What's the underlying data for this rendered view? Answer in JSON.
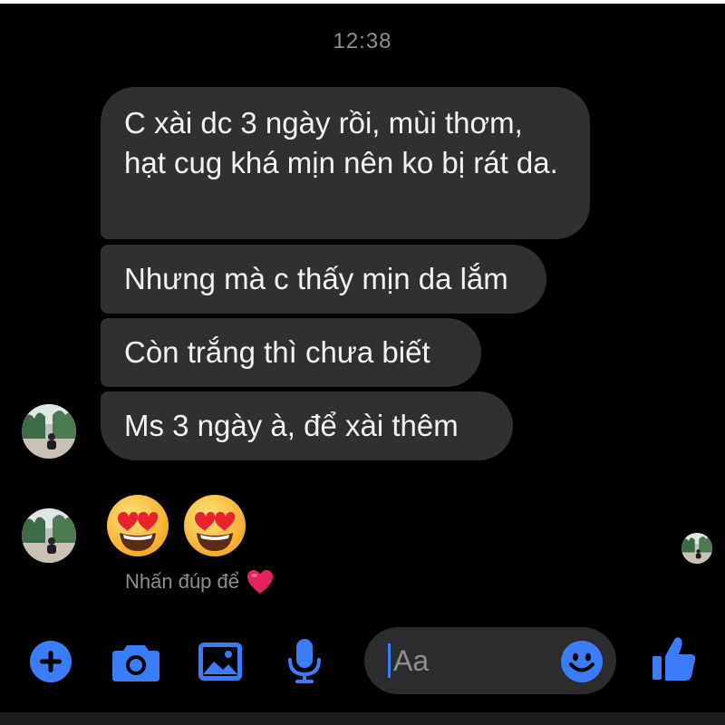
{
  "header": {
    "time": "12:38"
  },
  "messages": [
    {
      "text": "C xài dc 3 ngày rồi, mùi thơm, hạt cug khá mịn nên ko bị rát da."
    },
    {
      "text": "Nhưng mà c thấy mịn da lắm"
    },
    {
      "text": "Còn trắng thì chưa biết"
    },
    {
      "text": "Ms 3 ngày à, để xài thêm"
    }
  ],
  "emoji_message": {
    "emojis": [
      "heart-eyes-emoji",
      "heart-eyes-emoji"
    ]
  },
  "hint": {
    "text": "Nhấn đúp để",
    "emoji": "red-heart-icon"
  },
  "composer": {
    "placeholder": "Aa",
    "icons": [
      "plus-icon",
      "camera-icon",
      "image-icon",
      "microphone-icon",
      "smiley-icon",
      "thumbs-up-icon"
    ]
  },
  "colors": {
    "accent": "#3b7df8",
    "bubble": "#303033",
    "background": "#000000",
    "secondary_text": "#8e8e93",
    "heart": "#e0245e"
  }
}
